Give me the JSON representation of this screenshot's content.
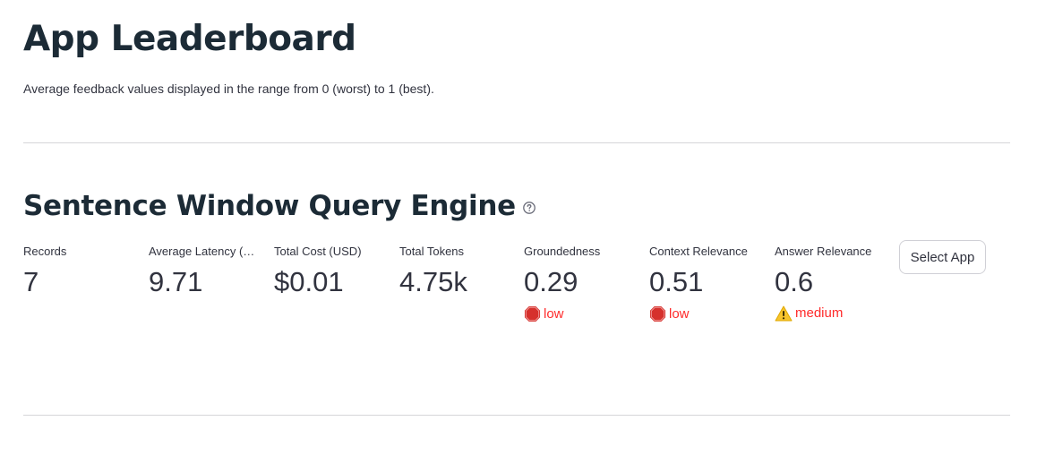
{
  "page": {
    "title": "App Leaderboard",
    "subtitle": "Average feedback values displayed in the range from 0 (worst) to 1 (best)."
  },
  "app": {
    "name": "Sentence Window Query Engine",
    "help_icon": "question-circle-icon",
    "metrics": [
      {
        "label": "Records",
        "value": "7"
      },
      {
        "label": "Average Latency (Seconds)",
        "value": "9.71"
      },
      {
        "label": "Total Cost (USD)",
        "value": "$0.01"
      },
      {
        "label": "Total Tokens",
        "value": "4.75k"
      },
      {
        "label": "Groundedness",
        "value": "0.29",
        "status": "low",
        "status_icon": "stop-sign-icon"
      },
      {
        "label": "Context Relevance",
        "value": "0.51",
        "status": "low",
        "status_icon": "stop-sign-icon"
      },
      {
        "label": "Answer Relevance",
        "value": "0.6",
        "status": "medium",
        "status_icon": "warning-icon"
      }
    ],
    "select_button_label": "Select App"
  },
  "colors": {
    "title": "#1c2b36",
    "text": "#31333f",
    "status_low": "#ff2b2b",
    "status_medium": "#ff2b2b",
    "divider": "#d6d6d9"
  }
}
